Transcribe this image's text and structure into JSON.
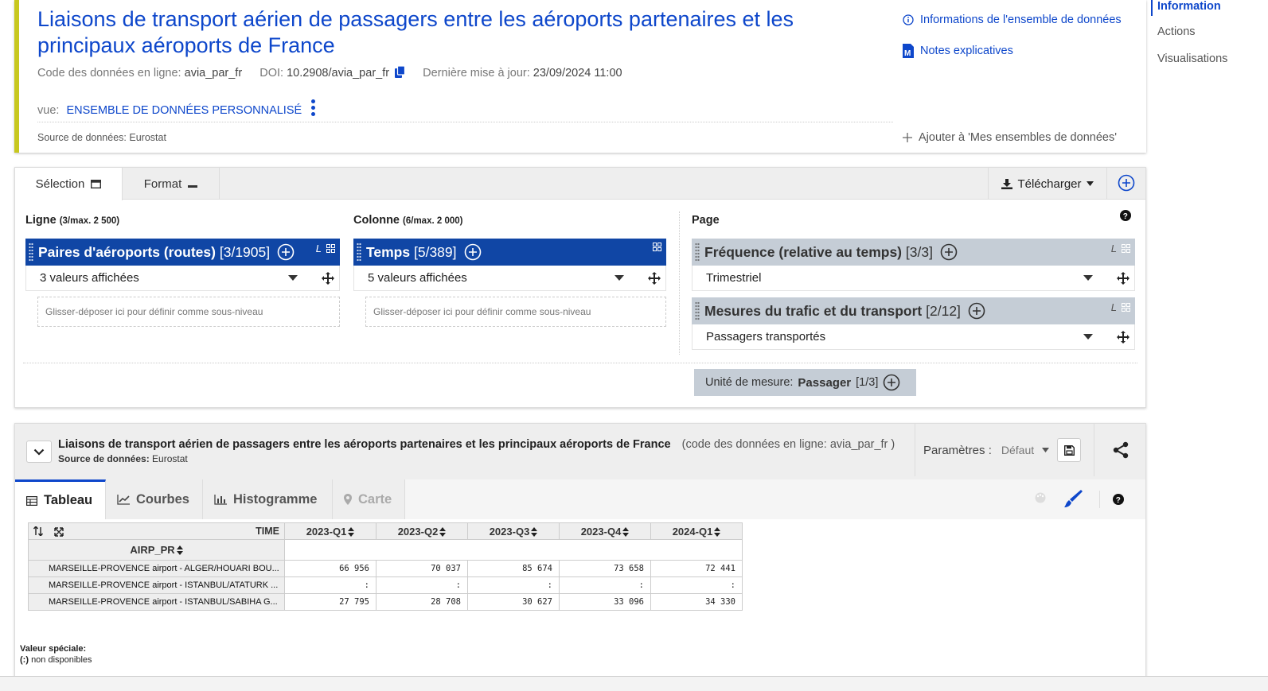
{
  "header": {
    "title": "Liaisons de transport aérien de passagers entre les aéroports partenaires et les principaux aéroports de France",
    "code_label": "Code des données en ligne:",
    "code_value": "avia_par_fr",
    "doi_label": "DOI:",
    "doi_value": "10.2908/avia_par_fr",
    "updated_label": "Dernière mise à jour:",
    "updated_value": "23/09/2024 11:00",
    "view_label": "vue:",
    "view_value": "ENSEMBLE DE DONNÉES PERSONNALISÉ",
    "source_label": "Source de données:",
    "source_value": "Eurostat",
    "info_link": "Informations de l'ensemble de données",
    "notes_link": "Notes explicatives",
    "add_link": "Ajouter à 'Mes ensembles de données'"
  },
  "right_nav": {
    "items": [
      "Information",
      "Actions",
      "Visualisations"
    ]
  },
  "selection": {
    "tab_selection": "Sélection",
    "tab_format": "Format",
    "download": "Télécharger",
    "row_label": "Ligne",
    "row_limit": "(3/max. 2 500)",
    "col_label": "Colonne",
    "col_limit": "(6/max. 2 000)",
    "page_label": "Page",
    "dims": {
      "routes": {
        "name": "Paires d'aéroports (routes)",
        "count": "[3/1905]",
        "value": "3 valeurs affichées"
      },
      "time": {
        "name": "Temps",
        "count": "[5/389]",
        "value": "5 valeurs affichées"
      },
      "freq": {
        "name": "Fréquence (relative au temps)",
        "count": "[3/3]",
        "value": "Trimestriel"
      },
      "measures": {
        "name": "Mesures du trafic et du transport",
        "count": "[2/12]",
        "value": "Passagers transportés"
      }
    },
    "drop_hint": "Glisser-déposer ici pour définir comme sous-niveau",
    "unit_label": "Unité de mesure:",
    "unit_value": "Passager",
    "unit_count": "[1/3]",
    "l_mark": "L"
  },
  "data_panel": {
    "title": "Liaisons de transport aérien de passagers entre les aéroports partenaires et les principaux aéroports de France",
    "code": "(code des données en ligne: avia_par_fr )",
    "source_label": "Source de données:",
    "source_value": "Eurostat",
    "params_label": "Paramètres :",
    "params_value": "Défaut",
    "tabs": [
      "Tableau",
      "Courbes",
      "Histogramme",
      "Carte"
    ]
  },
  "table": {
    "time_header": "TIME",
    "row_dim_header": "AIRP_PR",
    "columns": [
      "2023-Q1",
      "2023-Q2",
      "2023-Q3",
      "2023-Q4",
      "2024-Q1"
    ],
    "rows": [
      {
        "label": "MARSEILLE-PROVENCE airport - ALGER/HOUARI BOU...",
        "values": [
          "66 956",
          "70 037",
          "85 674",
          "73 658",
          "72 441"
        ]
      },
      {
        "label": "MARSEILLE-PROVENCE airport - ISTANBUL/ATATURK ...",
        "values": [
          ":",
          ":",
          ":",
          ":",
          ":"
        ]
      },
      {
        "label": "MARSEILLE-PROVENCE airport - ISTANBUL/SABIHA G...",
        "values": [
          "27 795",
          "28 708",
          "30 627",
          "33 096",
          "34 330"
        ]
      }
    ]
  },
  "special": {
    "title": "Valeur spéciale:",
    "symbol": "(:)",
    "text": "non disponibles"
  },
  "colors": {
    "accent": "#0e47cb",
    "dim_blue": "#1046a5",
    "dim_grey": "#c5cdd6",
    "header_stripe": "#c8c81f"
  }
}
